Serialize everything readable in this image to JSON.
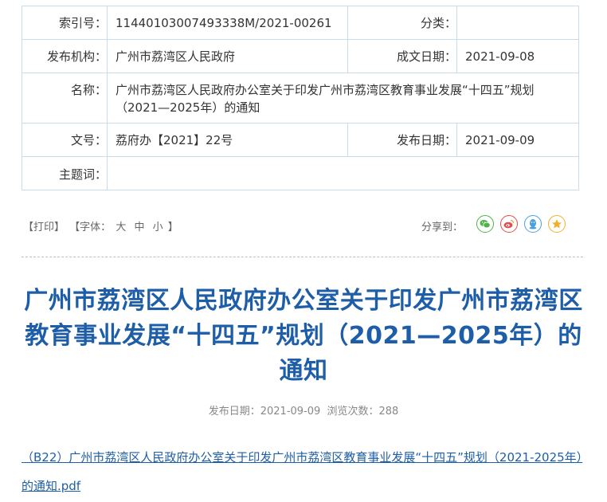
{
  "meta": {
    "index_label": "索引号：",
    "index_value": "11440103007493338M/2021-00261",
    "category_label": "分类：",
    "category_value": "",
    "agency_label": "发布机构：",
    "agency_value": "广州市荔湾区人民政府",
    "created_label": "成文日期：",
    "created_value": "2021-09-08",
    "name_label": "名称：",
    "name_value": "广州市荔湾区人民政府办公室关于印发广州市荔湾区教育事业发展“十四五”规划（2021—2025年）的通知",
    "docno_label": "文号：",
    "docno_value": "荔府办【2021】22号",
    "published_label": "发布日期：",
    "published_value": "2021-09-09",
    "subject_label": "主题词：",
    "subject_value": ""
  },
  "toolbar": {
    "print": "【打印】",
    "font_prefix": "【字体：",
    "size_large": "大",
    "size_medium": "中",
    "size_small": "小",
    "font_suffix": "】",
    "share_label": "分享到：",
    "share_icons": [
      "wechat-icon",
      "weibo-icon",
      "qq-icon",
      "qzone-icon"
    ]
  },
  "article": {
    "title": "广州市荔湾区人民政府办公室关于印发广州市荔湾区教育事业发展“十四五”规划（2021—2025年）的通知",
    "publish_label": "发布日期：2021-09-09",
    "views_label": "浏览次数：288",
    "attachment": "（B22）广州市荔湾区人民政府办公室关于印发广州市荔湾区教育事业发展“十四五”规划（2021-2025年）的通知.pdf"
  },
  "colors": {
    "title": "#1e5ea8",
    "table_border": "#c8dcea",
    "wechat": "#4fb34a",
    "weibo": "#e24d4d",
    "qq": "#4a9fe0",
    "qzone": "#f0b02a"
  }
}
